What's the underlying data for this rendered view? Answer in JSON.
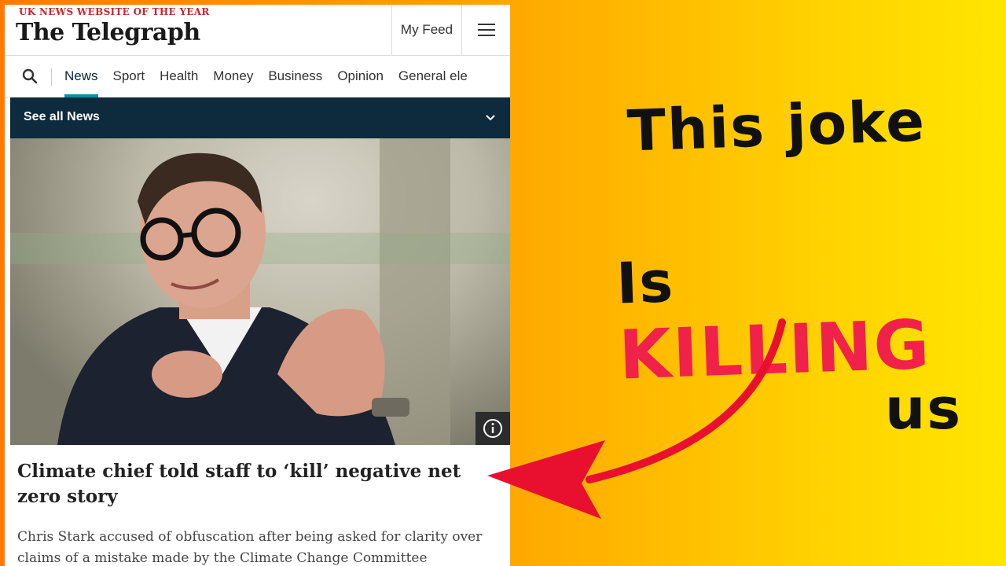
{
  "header": {
    "tagline": "UK NEWS WEBSITE OF THE YEAR",
    "logo": "The Telegraph",
    "myfeed_label": "My Feed"
  },
  "nav": {
    "items": [
      "News",
      "Sport",
      "Health",
      "Money",
      "Business",
      "Opinion",
      "General ele"
    ],
    "active": "News"
  },
  "section_bar": {
    "label": "See all News"
  },
  "article": {
    "headline": "Climate chief told staff to ‘kill’ negative net zero story",
    "standfirst": "Chris Stark accused of obfuscation after being asked for clarity over claims of a mistake made by the Climate Change Committee"
  },
  "overlay": {
    "line1": "This joke",
    "line2_prefix": "Is",
    "line2_highlight": "KILLING",
    "line3": "us",
    "highlight_color": "#f0214a",
    "arrow_color": "#e8102e"
  },
  "icons": {
    "search": "search-icon",
    "menu": "hamburger-menu-icon",
    "chevron": "chevron-down-icon",
    "info": "info-icon"
  }
}
